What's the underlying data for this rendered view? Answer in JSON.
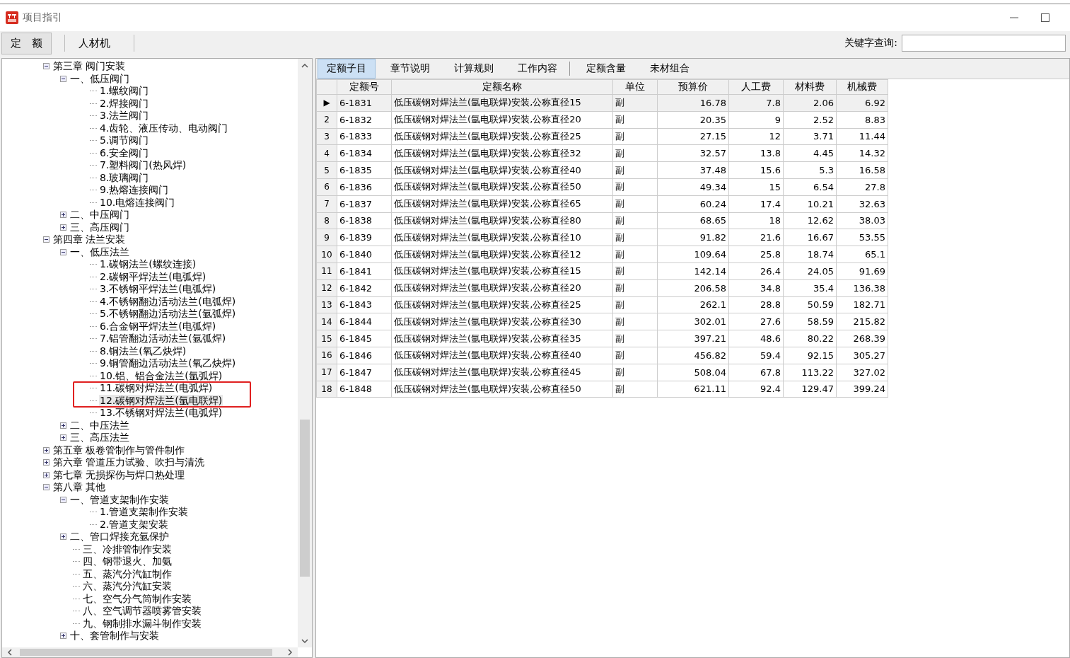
{
  "window": {
    "title": "项目指引"
  },
  "tabs": [
    {
      "label": "定　额",
      "selected": true
    },
    {
      "label": "人材机",
      "selected": false
    }
  ],
  "search": {
    "label": "关键字查询:"
  },
  "tree": [
    {
      "label": "第三章 阀门安装",
      "expanded": true,
      "selected": false,
      "children": [
        {
          "label": "一、低压阀门",
          "expanded": true,
          "selected": false,
          "children": [
            {
              "label": "1.螺纹阀门",
              "selected": false
            },
            {
              "label": "2.焊接阀门",
              "selected": false
            },
            {
              "label": "3.法兰阀门",
              "selected": false
            },
            {
              "label": "4.齿轮、液压传动、电动阀门",
              "selected": false
            },
            {
              "label": "5.调节阀门",
              "selected": false
            },
            {
              "label": "6.安全阀门",
              "selected": false
            },
            {
              "label": "7.塑料阀门(热风焊)",
              "selected": false
            },
            {
              "label": "8.玻璃阀门",
              "selected": false
            },
            {
              "label": "9.热熔连接阀门",
              "selected": false
            },
            {
              "label": "10.电熔连接阀门",
              "selected": false
            }
          ]
        },
        {
          "label": "二、中压阀门",
          "expanded": false,
          "selected": false
        },
        {
          "label": "三、高压阀门",
          "expanded": false,
          "selected": false
        }
      ]
    },
    {
      "label": "第四章 法兰安装",
      "expanded": true,
      "selected": false,
      "children": [
        {
          "label": "一、低压法兰",
          "expanded": true,
          "selected": false,
          "children": [
            {
              "label": "1.碳钢法兰(螺纹连接)",
              "selected": false
            },
            {
              "label": "2.碳钢平焊法兰(电弧焊)",
              "selected": false
            },
            {
              "label": "3.不锈钢平焊法兰(电弧焊)",
              "selected": false
            },
            {
              "label": "4.不锈钢翻边活动法兰(电弧焊)",
              "selected": false
            },
            {
              "label": "5.不锈钢翻边活动法兰(氩弧焊)",
              "selected": false
            },
            {
              "label": "6.合金钢平焊法兰(电弧焊)",
              "selected": false
            },
            {
              "label": "7.铝管翻边活动法兰(氩弧焊)",
              "selected": false
            },
            {
              "label": "8.铜法兰(氧乙炔焊)",
              "selected": false
            },
            {
              "label": "9.铜管翻边活动法兰(氧乙炔焊)",
              "selected": false
            },
            {
              "label": "10.铝、铝合金法兰(氩弧焊)",
              "selected": false
            },
            {
              "label": "11.碳钢对焊法兰(电弧焊)",
              "selected": false,
              "outlined": true
            },
            {
              "label": "12.碳钢对焊法兰(氩电联焊)",
              "selected": true,
              "outlined": true
            },
            {
              "label": "13.不锈钢对焊法兰(电弧焊)",
              "selected": false
            }
          ]
        },
        {
          "label": "二、中压法兰",
          "expanded": false,
          "selected": false
        },
        {
          "label": "三、高压法兰",
          "expanded": false,
          "selected": false
        }
      ]
    },
    {
      "label": "第五章 板卷管制作与管件制作",
      "expanded": false,
      "selected": false
    },
    {
      "label": "第六章 管道压力试验、吹扫与清洗",
      "expanded": false,
      "selected": false
    },
    {
      "label": "第七章 无损探伤与焊口热处理",
      "expanded": false,
      "selected": false
    },
    {
      "label": "第八章 其他",
      "expanded": true,
      "selected": false,
      "children": [
        {
          "label": "一、管道支架制作安装",
          "expanded": true,
          "selected": false,
          "children": [
            {
              "label": "1.管道支架制作安装",
              "selected": false
            },
            {
              "label": "2.管道支架安装",
              "selected": false
            }
          ]
        },
        {
          "label": "二、管口焊接充氩保护",
          "expanded": false,
          "selected": false
        },
        {
          "label": "三、冷排管制作安装",
          "selected": false
        },
        {
          "label": "四、钢带退火、加氨",
          "selected": false
        },
        {
          "label": "五、蒸汽分汽缸制作",
          "selected": false
        },
        {
          "label": "六、蒸汽分汽缸安装",
          "selected": false
        },
        {
          "label": "七、空气分气筒制作安装",
          "selected": false
        },
        {
          "label": "八、空气调节器喷雾管安装",
          "selected": false
        },
        {
          "label": "九、钢制排水漏斗制作安装",
          "selected": false
        },
        {
          "label": "十、套管制作与安装",
          "expanded": false,
          "selected": false
        }
      ]
    }
  ],
  "detail_tabs": [
    {
      "label": "定额子目",
      "selected": true
    },
    {
      "label": "章节说明",
      "selected": false
    },
    {
      "label": "计算规则",
      "selected": false
    },
    {
      "label": "工作内容",
      "selected": false
    },
    {
      "label": "定额含量",
      "selected": false
    },
    {
      "label": "未材组合",
      "selected": false
    }
  ],
  "table": {
    "columns": [
      "定额号",
      "定额名称",
      "单位",
      "预算价",
      "人工费",
      "材料费",
      "机械费"
    ],
    "rows": [
      {
        "marker": "▶",
        "selected": true,
        "cells": [
          "6-1831",
          "低压碳钢对焊法兰(氩电联焊)安装,公称直径15",
          "副",
          "16.78",
          "7.8",
          "2.06",
          "6.92"
        ]
      },
      {
        "marker": "2",
        "selected": false,
        "cells": [
          "6-1832",
          "低压碳钢对焊法兰(氩电联焊)安装,公称直径20",
          "副",
          "20.35",
          "9",
          "2.52",
          "8.83"
        ]
      },
      {
        "marker": "3",
        "selected": false,
        "cells": [
          "6-1833",
          "低压碳钢对焊法兰(氩电联焊)安装,公称直径25",
          "副",
          "27.15",
          "12",
          "3.71",
          "11.44"
        ]
      },
      {
        "marker": "4",
        "selected": false,
        "cells": [
          "6-1834",
          "低压碳钢对焊法兰(氩电联焊)安装,公称直径32",
          "副",
          "32.57",
          "13.8",
          "4.45",
          "14.32"
        ]
      },
      {
        "marker": "5",
        "selected": false,
        "cells": [
          "6-1835",
          "低压碳钢对焊法兰(氩电联焊)安装,公称直径40",
          "副",
          "37.48",
          "15.6",
          "5.3",
          "16.58"
        ]
      },
      {
        "marker": "6",
        "selected": false,
        "cells": [
          "6-1836",
          "低压碳钢对焊法兰(氩电联焊)安装,公称直径50",
          "副",
          "49.34",
          "15",
          "6.54",
          "27.8"
        ]
      },
      {
        "marker": "7",
        "selected": false,
        "cells": [
          "6-1837",
          "低压碳钢对焊法兰(氩电联焊)安装,公称直径65",
          "副",
          "60.24",
          "17.4",
          "10.21",
          "32.63"
        ]
      },
      {
        "marker": "8",
        "selected": false,
        "cells": [
          "6-1838",
          "低压碳钢对焊法兰(氩电联焊)安装,公称直径80",
          "副",
          "68.65",
          "18",
          "12.62",
          "38.03"
        ]
      },
      {
        "marker": "9",
        "selected": false,
        "cells": [
          "6-1839",
          "低压碳钢对焊法兰(氩电联焊)安装,公称直径10",
          "副",
          "91.82",
          "21.6",
          "16.67",
          "53.55"
        ]
      },
      {
        "marker": "10",
        "selected": false,
        "cells": [
          "6-1840",
          "低压碳钢对焊法兰(氩电联焊)安装,公称直径12",
          "副",
          "109.64",
          "25.8",
          "18.74",
          "65.1"
        ]
      },
      {
        "marker": "11",
        "selected": false,
        "cells": [
          "6-1841",
          "低压碳钢对焊法兰(氩电联焊)安装,公称直径15",
          "副",
          "142.14",
          "26.4",
          "24.05",
          "91.69"
        ]
      },
      {
        "marker": "12",
        "selected": false,
        "cells": [
          "6-1842",
          "低压碳钢对焊法兰(氩电联焊)安装,公称直径20",
          "副",
          "206.58",
          "34.8",
          "35.4",
          "136.38"
        ]
      },
      {
        "marker": "13",
        "selected": false,
        "cells": [
          "6-1843",
          "低压碳钢对焊法兰(氩电联焊)安装,公称直径25",
          "副",
          "262.1",
          "28.8",
          "50.59",
          "182.71"
        ]
      },
      {
        "marker": "14",
        "selected": false,
        "cells": [
          "6-1844",
          "低压碳钢对焊法兰(氩电联焊)安装,公称直径30",
          "副",
          "302.01",
          "27.6",
          "58.59",
          "215.82"
        ]
      },
      {
        "marker": "15",
        "selected": false,
        "cells": [
          "6-1845",
          "低压碳钢对焊法兰(氩电联焊)安装,公称直径35",
          "副",
          "397.21",
          "48.6",
          "80.22",
          "268.39"
        ]
      },
      {
        "marker": "16",
        "selected": false,
        "cells": [
          "6-1846",
          "低压碳钢对焊法兰(氩电联焊)安装,公称直径40",
          "副",
          "456.82",
          "59.4",
          "92.15",
          "305.27"
        ]
      },
      {
        "marker": "17",
        "selected": false,
        "cells": [
          "6-1847",
          "低压碳钢对焊法兰(氩电联焊)安装,公称直径45",
          "副",
          "508.04",
          "67.8",
          "113.22",
          "327.02"
        ]
      },
      {
        "marker": "18",
        "selected": false,
        "cells": [
          "6-1848",
          "低压碳钢对焊法兰(氩电联焊)安装,公称直径50",
          "副",
          "621.11",
          "92.4",
          "129.47",
          "399.24"
        ]
      }
    ]
  }
}
